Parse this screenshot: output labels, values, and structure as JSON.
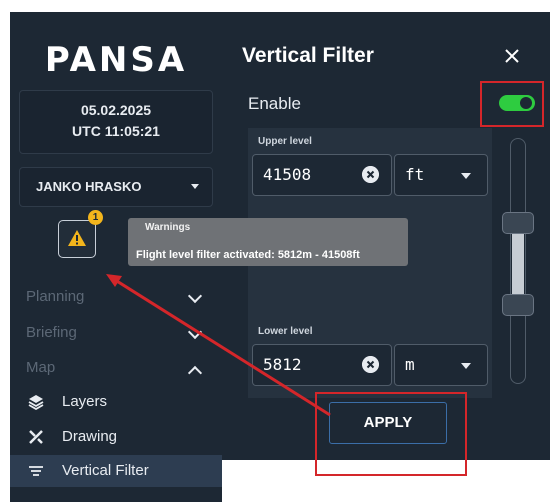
{
  "sidebar": {
    "logo_text": "PANSA",
    "date": "05.02.2025",
    "utc_time": "UTC 11:05:21",
    "user_name": "JANKO HRASKO",
    "warnings_badge_count": "1",
    "menu": [
      {
        "label": "Planning",
        "state": "collapsed"
      },
      {
        "label": "Briefing",
        "state": "collapsed"
      },
      {
        "label": "Map",
        "state": "expanded"
      }
    ],
    "map_items": [
      {
        "label": "Layers",
        "icon": "layers-icon"
      },
      {
        "label": "Drawing",
        "icon": "drawing-icon"
      },
      {
        "label": "Vertical Filter",
        "icon": "filter-lines-icon",
        "active": true
      }
    ]
  },
  "tooltip": {
    "title": "Warnings",
    "message": "Flight level filter activated: 5812m - 41508ft"
  },
  "panel": {
    "title": "Vertical Filter",
    "enable_label": "Enable",
    "enable_on": true,
    "upper": {
      "label": "Upper level",
      "value": "41508",
      "unit": "ft"
    },
    "lower": {
      "label": "Lower level",
      "value": "5812",
      "unit": "m"
    },
    "apply_label": "APPLY"
  },
  "colors": {
    "panel_bg": "#1d2834",
    "toggle_on": "#2ecc40",
    "warning_yellow": "#f3b51c",
    "annotation_red": "#d4262a",
    "apply_border": "#3b6ea8"
  }
}
